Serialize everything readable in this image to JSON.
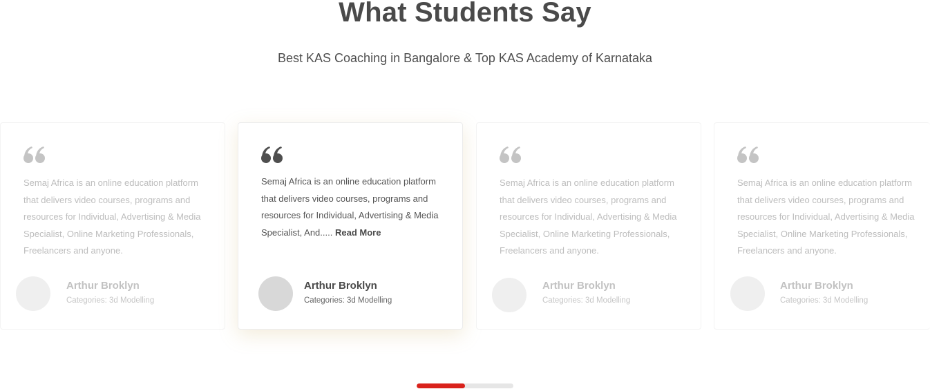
{
  "section": {
    "title": "What Students Say",
    "subtitle": "Best KAS Coaching in Bangalore & Top KAS Academy of Karnataka"
  },
  "testimonials": [
    {
      "text": "Semaj Africa is an online education platform that delivers video courses, programs and resources for Individual, Advertising & Media Specialist, Online Marketing Professionals, Freelancers and anyone.",
      "author": "Arthur Broklyn",
      "meta": "Categories: 3d Modelling",
      "active": false
    },
    {
      "text": "Semaj Africa is an online education platform that delivers video courses, programs and resources for Individual, Advertising & Media Specialist,  And.....",
      "read_more": "Read More",
      "author": "Arthur Broklyn",
      "meta": "Categories: 3d Modelling",
      "active": true
    },
    {
      "text": "Semaj Africa is an online education platform that delivers video courses, programs and resources for Individual, Advertising & Media Specialist, Online Marketing Professionals, Freelancers and anyone.",
      "author": "Arthur Broklyn",
      "meta": "Categories: 3d Modelling",
      "active": false
    },
    {
      "text": "Semaj Africa is an online education platform that delivers video courses, programs and resources for Individual, Advertising & Media Specialist, Online Marketing Professionals, Freelancers and anyone.",
      "author": "Arthur Broklyn",
      "meta": "Categories: 3d Modelling",
      "active": false
    }
  ],
  "pagination": {
    "progress": 0.5,
    "fill_color": "#d9221c",
    "track_color": "#e6e6e6"
  },
  "colors": {
    "quote_active": "#4f4f4f",
    "quote_inactive": "#c4c4c4"
  }
}
